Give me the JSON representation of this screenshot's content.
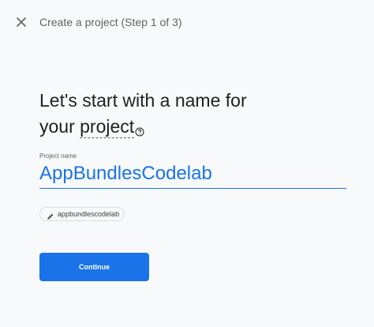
{
  "header": {
    "close_icon": "close-icon",
    "title": "Create a project (Step 1 of 3)"
  },
  "heading": {
    "line1": "Let's start with a name for",
    "line2_prefix": "your ",
    "line2_link": "project",
    "help_icon": "help-circle-icon"
  },
  "project_name": {
    "label": "Project name",
    "value": "AppBundlesCodelab"
  },
  "project_id_chip": {
    "icon": "pencil-icon",
    "text": "appbundlescodelab"
  },
  "continue_button": {
    "label": "Continue"
  },
  "colors": {
    "accent": "#1a73e8",
    "background": "#f8f9fa",
    "text_primary": "#202124",
    "text_secondary": "#5f6368"
  }
}
